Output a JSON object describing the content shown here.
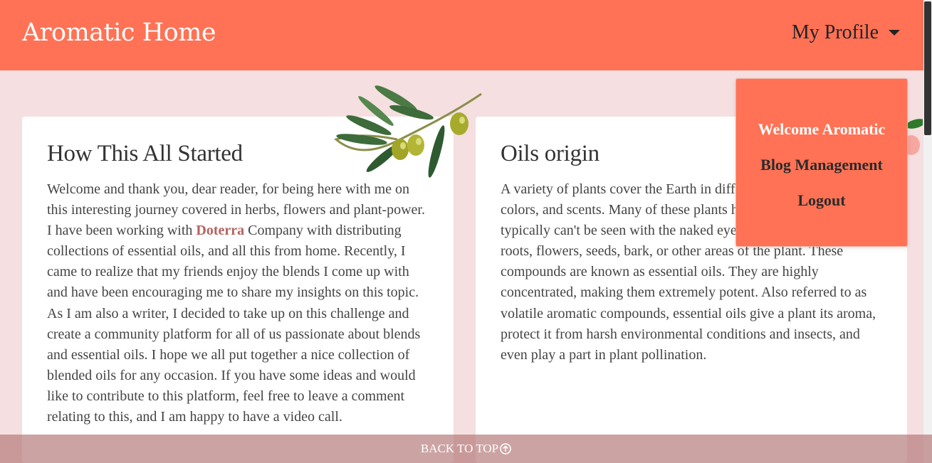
{
  "header": {
    "brand": "Aromatic Home",
    "profile_label": "My Profile"
  },
  "cards": [
    {
      "title": "How This All Started",
      "text_before_link": "Welcome and thank you, dear reader, for being here with me on this interesting journey covered in herbs, flowers and plant-power. I have been working with ",
      "link_text": "Doterra",
      "text_after_link": " Company with distributing collections of essential oils, and all this from home. Recently, I came to realize that my friends enjoy the blends I come up with and have been encouraging me to share my insights on this topic. As I am also a writer, I decided to take up on this challenge and create a community platform for all of us passionate about blends and essential oils. I hope we all put together a nice collection of blended oils for any occasion. If you have some ideas and would like to contribute to this platform, feel free to leave a comment relating to this, and I am happy to have a video call."
    },
    {
      "title": "Oils origin",
      "text": "A variety of plants cover the Earth in different shapes, sizes, colors, and scents. Many of these plants have compounds that typically can't be seen with the naked eye, they exist within the roots, flowers, seeds, bark, or other areas of the plant. These compounds are known as essential oils. They are highly concentrated, making them extremely potent. Also referred to as volatile aromatic compounds, essential oils give a plant its aroma, protect it from harsh environmental conditions and insects, and even play a part in plant pollination."
    }
  ],
  "dropdown": {
    "items": [
      "Welcome Aromatic",
      "Blog Management",
      "Logout"
    ]
  },
  "footer": {
    "back_to_top": "BACK TO TOP"
  },
  "colors": {
    "navbar": "#ff7255",
    "background": "#f5dfe0",
    "link": "#b4635f"
  },
  "icons": {
    "caret": "caret-down-icon",
    "back_to_top": "arrow-up-circle-icon",
    "decoration": "olive-branch-icon"
  }
}
